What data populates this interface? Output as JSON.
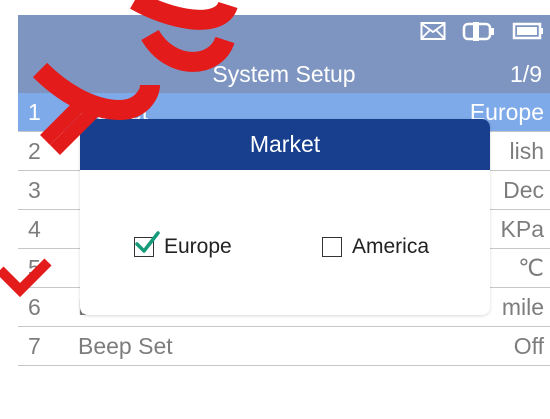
{
  "header": {
    "title": "System Setup",
    "page": "1/9"
  },
  "status_icons": [
    "mail-icon",
    "battery-clip-icon",
    "battery-icon"
  ],
  "menu": [
    {
      "num": "1",
      "label": "Market",
      "value": "Europe",
      "selected": true
    },
    {
      "num": "2",
      "label": "",
      "value": "lish"
    },
    {
      "num": "3",
      "label": "",
      "value": "Dec"
    },
    {
      "num": "4",
      "label": "",
      "value": "KPa"
    },
    {
      "num": "5",
      "label": "",
      "value": "℃"
    },
    {
      "num": "6",
      "label": "Distance Unit",
      "value": "mile"
    },
    {
      "num": "7",
      "label": "Beep Set",
      "value": "Off"
    }
  ],
  "dialog": {
    "title": "Market",
    "options": [
      {
        "label": "Europe",
        "checked": true
      },
      {
        "label": "America",
        "checked": false
      }
    ]
  },
  "colors": {
    "header": "#173f8e",
    "selected": "#1565d8",
    "checkmark": "#159a7a",
    "watermark": "#e31b1b"
  }
}
